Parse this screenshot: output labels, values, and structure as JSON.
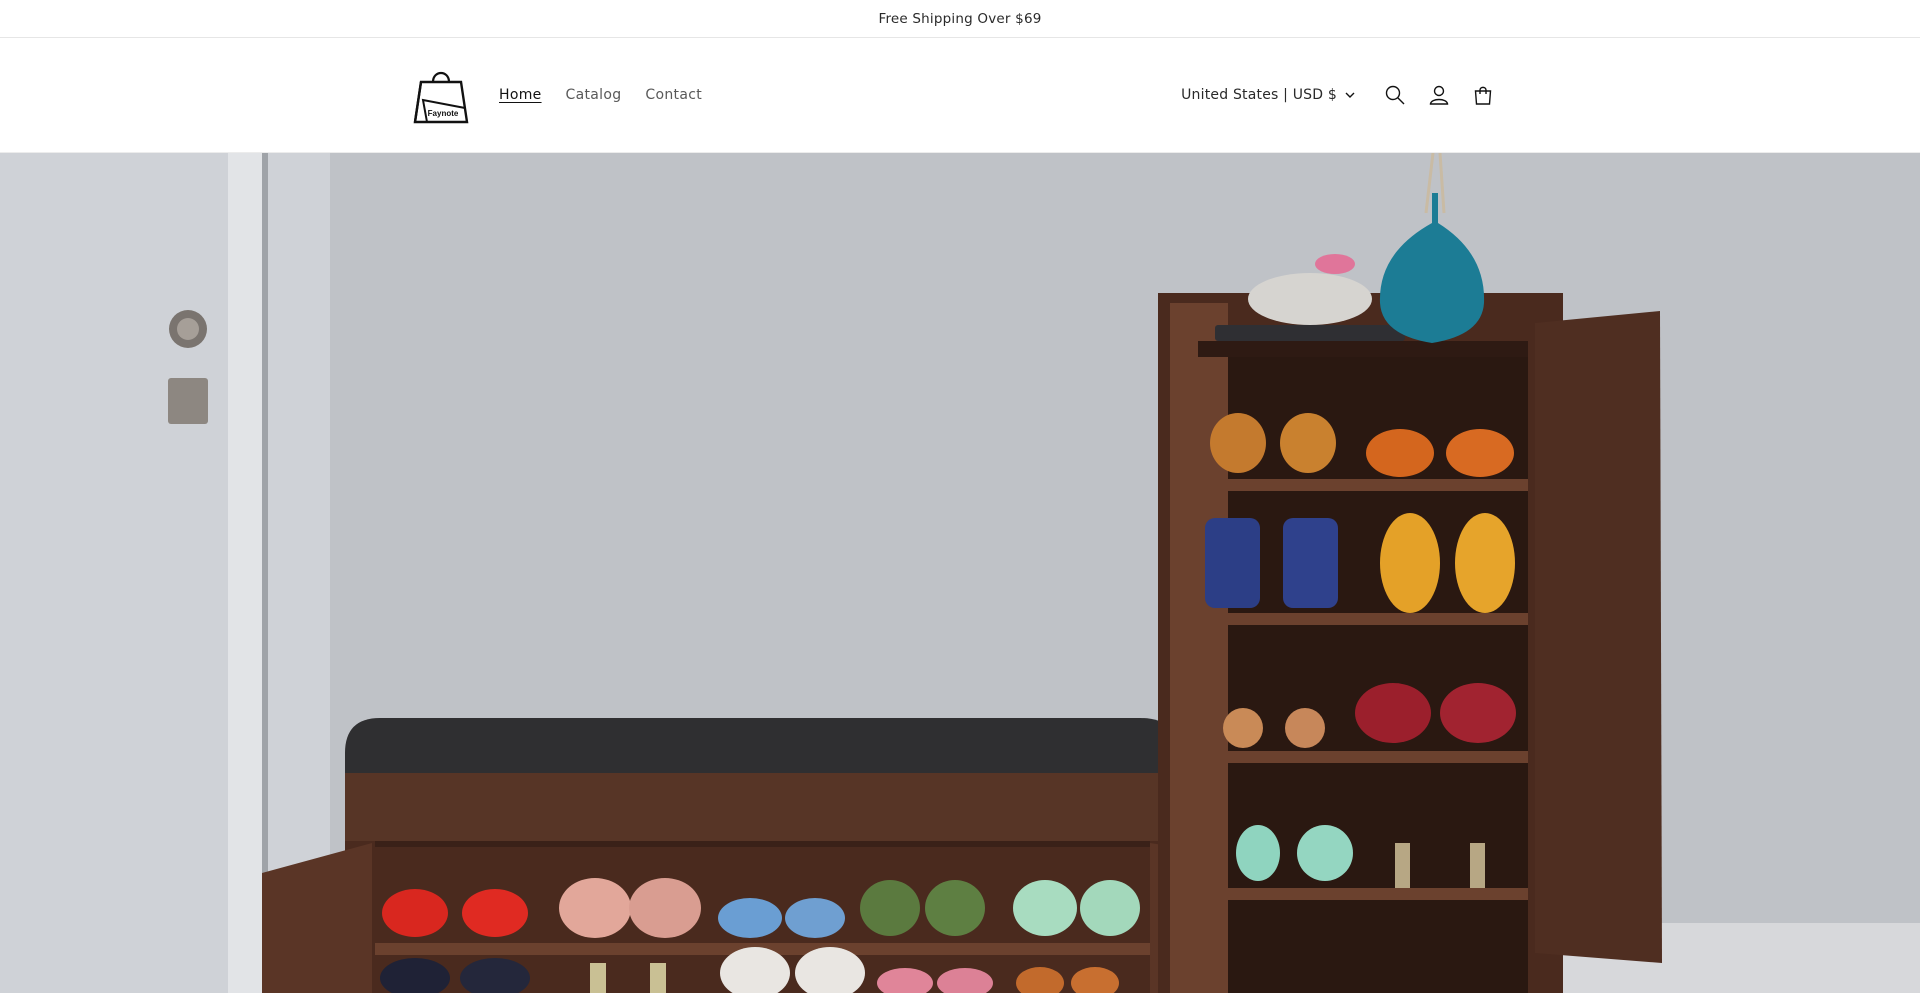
{
  "announcement": {
    "text": "Free Shipping Over $69"
  },
  "header": {
    "logo": {
      "brand": "Faynote",
      "icon": "shopping-bag-logo"
    },
    "nav": [
      {
        "label": "Home",
        "active": true
      },
      {
        "label": "Catalog",
        "active": false
      },
      {
        "label": "Contact",
        "active": false
      }
    ],
    "locale": {
      "label": "United States | USD $",
      "icon": "chevron-down-icon"
    },
    "icons": [
      "search-icon",
      "account-icon",
      "cart-icon"
    ]
  },
  "hero": {
    "image": "shoe-cabinet-bench-photo",
    "colors": {
      "wall": "#bfc2c7",
      "wood": "#4a2a1e",
      "cushion": "#2f2f31",
      "vase": "#1c7c95"
    }
  }
}
